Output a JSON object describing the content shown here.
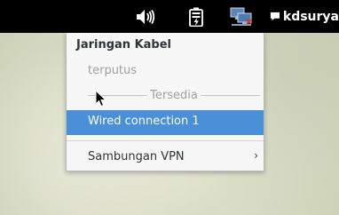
{
  "panel": {
    "user_label": "kdsurya",
    "icons": [
      "speaker-volume-icon",
      "battery-charging-icon",
      "network-wired-icon",
      "chat-icon"
    ]
  },
  "network_menu": {
    "title": "Jaringan Kabel",
    "status": "terputus",
    "section_label": "Tersedia",
    "connection_label": "Wired connection 1",
    "vpn_label": "Sambungan VPN",
    "vpn_arrow": "›"
  },
  "colors": {
    "panel": "#000000",
    "highlight": "#4a90d9",
    "menu_bg": "#f7f7f7"
  }
}
